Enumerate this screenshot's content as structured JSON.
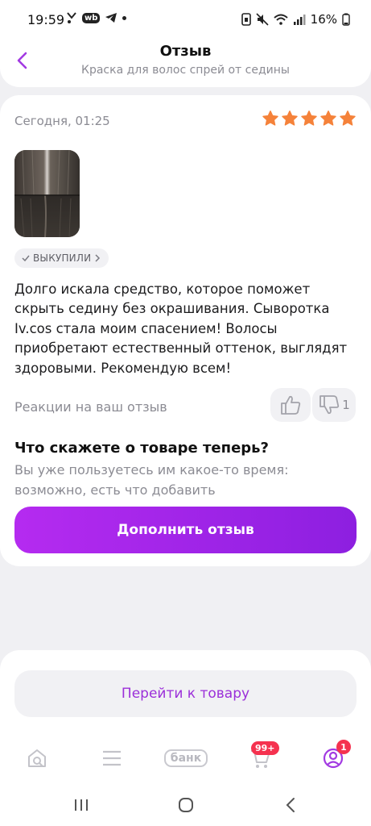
{
  "status_bar": {
    "time": "19:59",
    "wb_label": "wb",
    "battery": "16%"
  },
  "header": {
    "title": "Отзыв",
    "subtitle": "Краска для волос спрей от седины"
  },
  "review": {
    "date": "Сегодня, 01:25",
    "rating": 5,
    "star_color": "#f5823a",
    "badge_label": "ВЫКУПИЛИ",
    "text": "Долго искала средство, которое поможет скрыть седину без окрашивания. Сыворотка Iv.cos стала моим спасением! Волосы приобретают естественный оттенок, выглядят здоровыми. Рекомендую всем!",
    "reactions_label": "Реакции на ваш отзыв",
    "dislike_count": "1"
  },
  "update_prompt": {
    "title": "Что скажете о товаре теперь?",
    "subtitle": "Вы уже пользуетесь им какое-то время: возможно, есть что добавить",
    "button_label": "Дополнить отзыв"
  },
  "go_to_product": {
    "button_label": "Перейти к товару"
  },
  "tab_bar": {
    "bank_label": "банк",
    "cart_badge": "99+",
    "profile_badge": "1",
    "icons": [
      "home-search-icon",
      "menu-icon",
      "bank-icon",
      "cart-icon",
      "profile-icon"
    ]
  },
  "colors": {
    "accent": "#9b2fd9",
    "primary_button": "#a526ea",
    "badge_red": "#f5324f"
  }
}
